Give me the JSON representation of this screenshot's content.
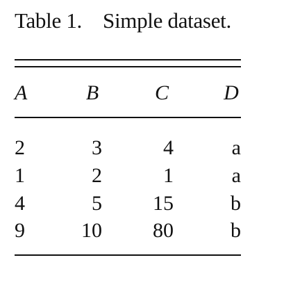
{
  "table": {
    "caption_label": "Table 1.",
    "caption_text": "Simple dataset.",
    "headers": [
      "A",
      "B",
      "C",
      "D"
    ],
    "rows": [
      [
        "2",
        "3",
        "4",
        "a"
      ],
      [
        "1",
        "2",
        "1",
        "a"
      ],
      [
        "4",
        "5",
        "15",
        "b"
      ],
      [
        "9",
        "10",
        "80",
        "b"
      ]
    ]
  }
}
